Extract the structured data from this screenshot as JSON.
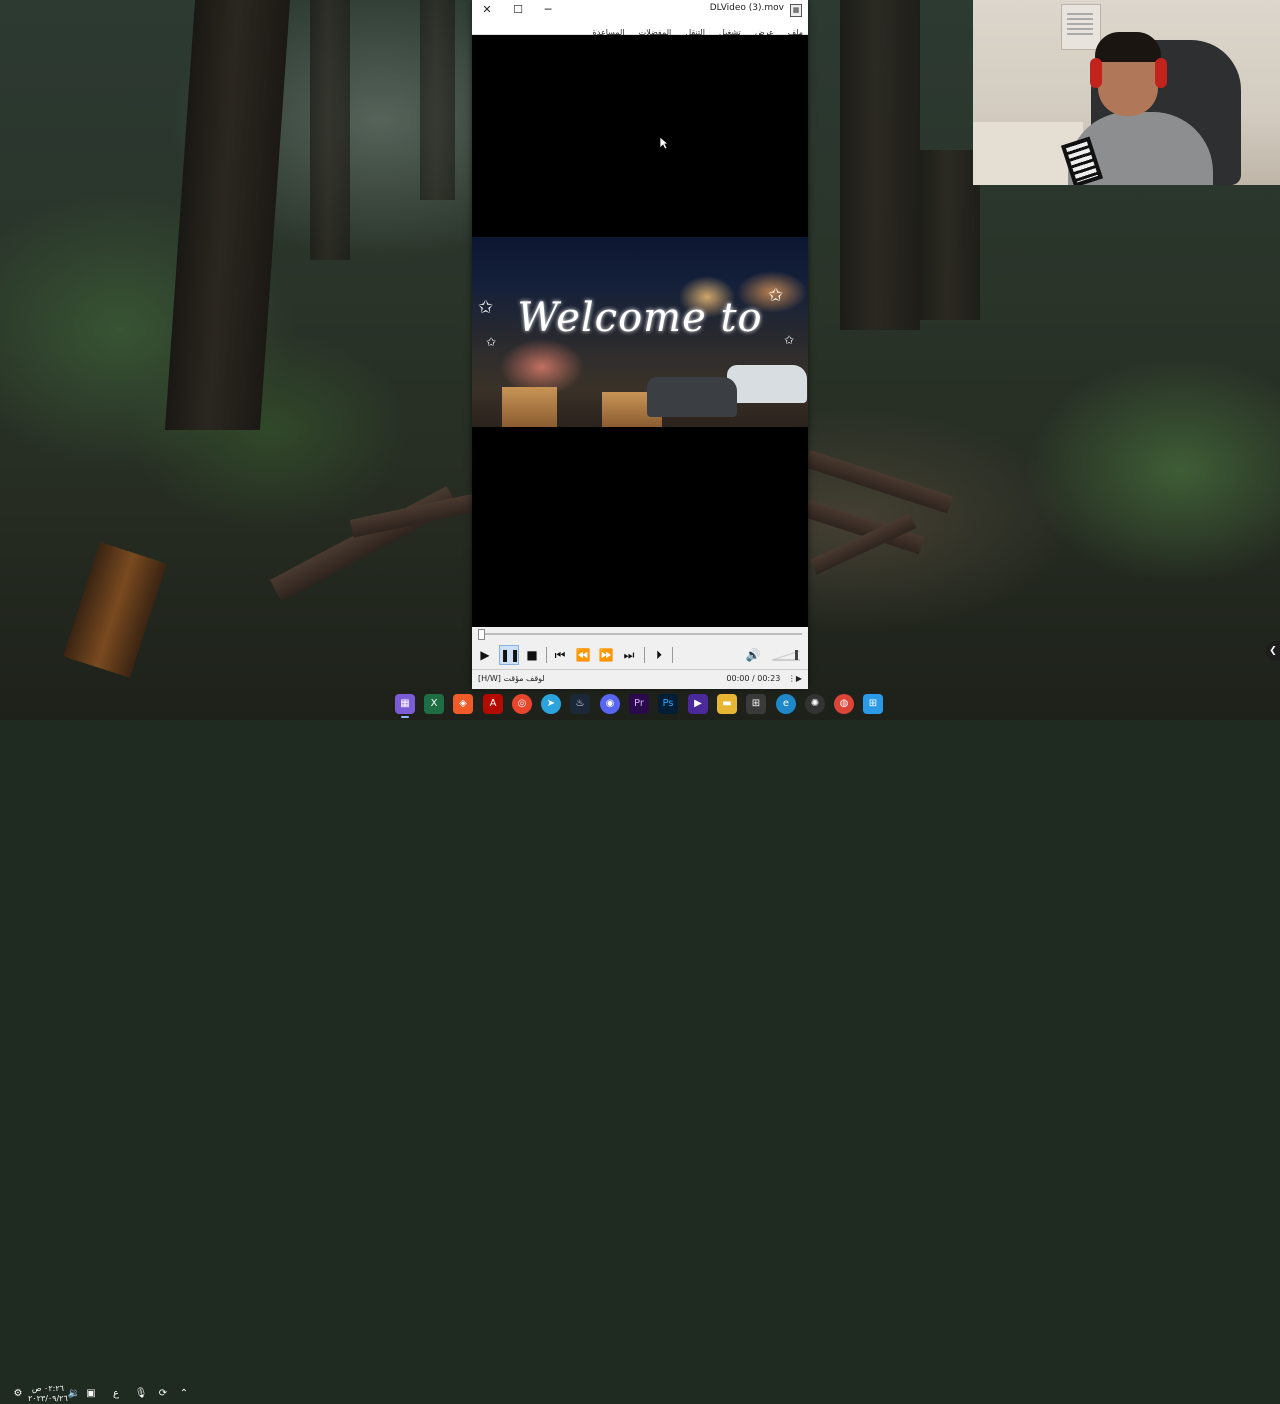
{
  "window": {
    "title": "DLVideo (3).mov",
    "controls": {
      "close": "✕",
      "maximize": "☐",
      "minimize": "─"
    }
  },
  "menu": {
    "items": [
      "ملف",
      "عرض",
      "تشغيل",
      "التنقل",
      "المفضلات",
      "المساعدة"
    ]
  },
  "video": {
    "overlay_text": "Welcome to"
  },
  "playback": {
    "current_time": "00:00",
    "duration": "00:23",
    "time_display": "00:00 / 00:23",
    "progress": 0.0,
    "volume": 0.85,
    "state": "paused"
  },
  "status": {
    "left_text": "[H/W] لوقف مؤقت",
    "right_icon": "menu-icon"
  },
  "controls": {
    "play": "play-icon",
    "pause": "pause-icon",
    "stop": "stop-icon",
    "prev": "skip-back-icon",
    "rewind": "rewind-icon",
    "forward": "fast-forward-icon",
    "next": "skip-forward-icon",
    "frame_step": "frame-step-icon",
    "volume": "speaker-icon"
  },
  "taskbar": {
    "clock_time": "٠٢:٢٦ ص",
    "clock_date": "٢٠٢٣/٠٩/٢٦",
    "lang": "ع",
    "apps": [
      "calendar",
      "excel",
      "brave",
      "acrobat",
      "app-red",
      "telegram",
      "steam",
      "discord",
      "premiere",
      "photoshop",
      "video-editor",
      "file-explorer",
      "store",
      "edge",
      "chatgpt",
      "chrome",
      "start"
    ]
  }
}
